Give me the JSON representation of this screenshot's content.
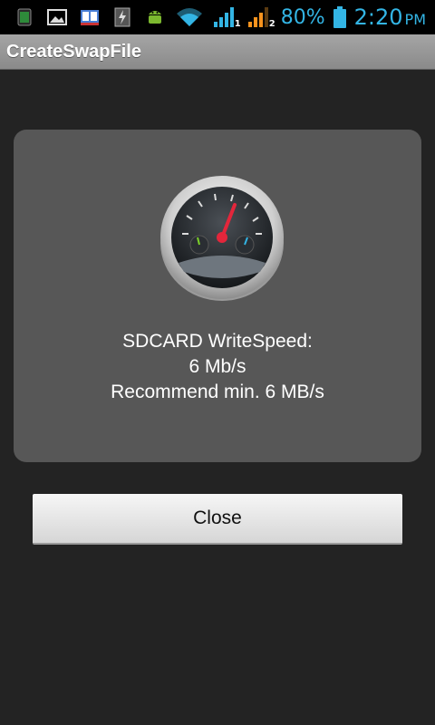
{
  "status_bar": {
    "left_icons": [
      "app-icon",
      "image-icon",
      "news-icon",
      "usb-icon",
      "android-icon"
    ],
    "signal_1_label": "1",
    "signal_2_label": "2",
    "battery_percent": "80%",
    "time": "2:20",
    "ampm": "PM",
    "accent_color": "#33b5e5",
    "signal_2_color": "#f7931e"
  },
  "app": {
    "title": "CreateSwapFile"
  },
  "speed_panel": {
    "gauge_icon": "speedometer-icon",
    "label": "SDCARD WriteSpeed:",
    "speed": "6 Mb/s",
    "recommendation": "Recommend min. 6 MB/s"
  },
  "actions": {
    "close_label": "Close"
  }
}
